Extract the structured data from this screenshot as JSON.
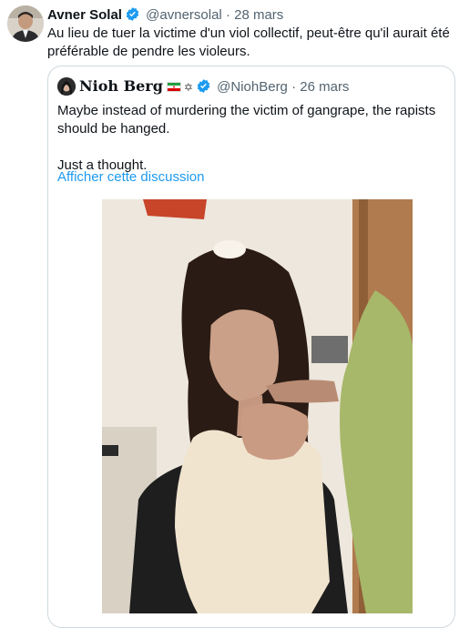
{
  "tweet": {
    "author_name": "Avner Solal",
    "author_handle": "@avnersolal",
    "separator": "·",
    "date": "28 mars",
    "text": "Au lieu de tuer la victime d'un viol collectif, peut-être qu'il aurait été préférable de pendre les violeurs."
  },
  "quote": {
    "author_name": "Nioh Berg",
    "author_emoji": "✡",
    "author_handle": "@NiohBerg",
    "separator": "·",
    "date": "26 mars",
    "text_line1": "Maybe instead of murdering the victim of gangrape, the rapists should be hanged.",
    "text_line2": "Just a thought.",
    "show_thread": "Afficher cette discussion",
    "media_icon": "photo-image"
  },
  "colors": {
    "link": "#1d9bf0",
    "secondary_text": "#536471",
    "border": "#cfd9de",
    "verified": "#1d9bf0"
  }
}
